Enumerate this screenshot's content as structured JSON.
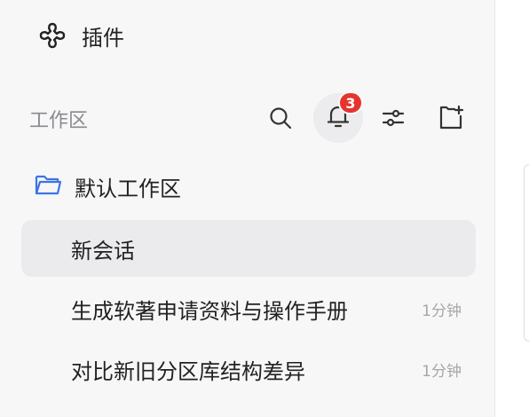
{
  "plugins": {
    "label": "插件",
    "icon": "puzzle-clover-icon"
  },
  "workspace_header": {
    "title": "工作区",
    "tools": {
      "search_icon": "search-icon",
      "bell_icon": "bell-icon",
      "notification_count": "3",
      "filter_icon": "sliders-icon",
      "new_folder_icon": "new-folder-icon"
    }
  },
  "workspace": {
    "label": "默认工作区",
    "icon": "folder-icon",
    "icon_color": "#3b74e6"
  },
  "conversations": [
    {
      "title": "新会话",
      "time": ""
    },
    {
      "title": "生成软著申请资料与操作手册",
      "time": "1分钟"
    },
    {
      "title": "对比新旧分区库结构差异",
      "time": "1分钟"
    }
  ],
  "colors": {
    "badge": "#e5342d",
    "sidebar_bg": "#f7f7f8",
    "active_bg": "#ebebed"
  }
}
